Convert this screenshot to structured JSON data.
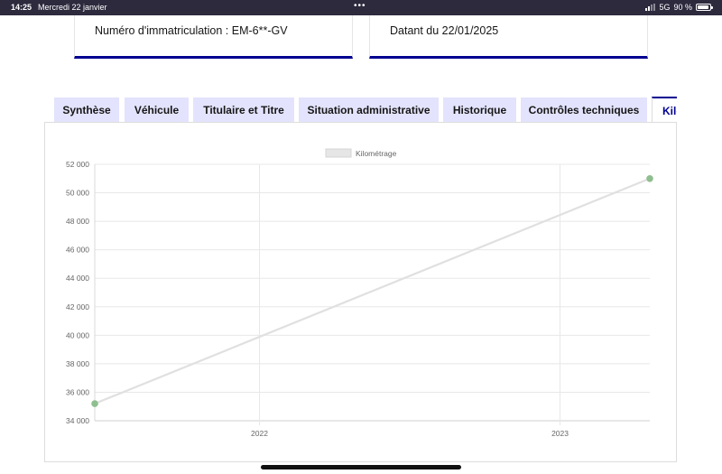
{
  "status_bar": {
    "time": "14:25",
    "date": "Mercredi 22 janvier",
    "dots": "•••",
    "network": "5G",
    "battery": "90 %",
    "battery_level": 0.9
  },
  "cards": [
    {
      "label": "Numéro d'immatriculation : EM-6**-GV"
    },
    {
      "label": "Datant du 22/01/2025"
    }
  ],
  "tabs": [
    {
      "label": "Synthèse",
      "active": false
    },
    {
      "label": "Véhicule",
      "active": false
    },
    {
      "label": "Titulaire et Titre",
      "active": false
    },
    {
      "label": "Situation administrative",
      "active": false
    },
    {
      "label": "Historique",
      "active": false
    },
    {
      "label": "Contrôles techniques",
      "active": false
    },
    {
      "label": "Kilométrage",
      "active": true
    }
  ],
  "colors": {
    "accent": "#000091",
    "tab_bg": "#e3e3fd",
    "line": "#e0e0e0",
    "point": "#8fbf8f",
    "grid": "#e8e8e8"
  },
  "chart_data": {
    "type": "line",
    "legend": "Kilométrage",
    "legend_position": "top",
    "x_ticks": [
      "2022",
      "2023"
    ],
    "y_ticks": [
      "34 000",
      "36 000",
      "38 000",
      "40 000",
      "42 000",
      "44 000",
      "46 000",
      "48 000",
      "50 000",
      "52 000"
    ],
    "ylim": [
      34000,
      52000
    ],
    "x_domain": [
      "2021-06-15",
      "2023-04-20"
    ],
    "x_tick_dates": [
      "2022-01-01",
      "2023-01-01"
    ],
    "series": [
      {
        "name": "Kilométrage",
        "points": [
          {
            "x": "2021-06-15",
            "y": 35200
          },
          {
            "x": "2023-04-20",
            "y": 51000
          }
        ]
      }
    ],
    "grid": true
  }
}
